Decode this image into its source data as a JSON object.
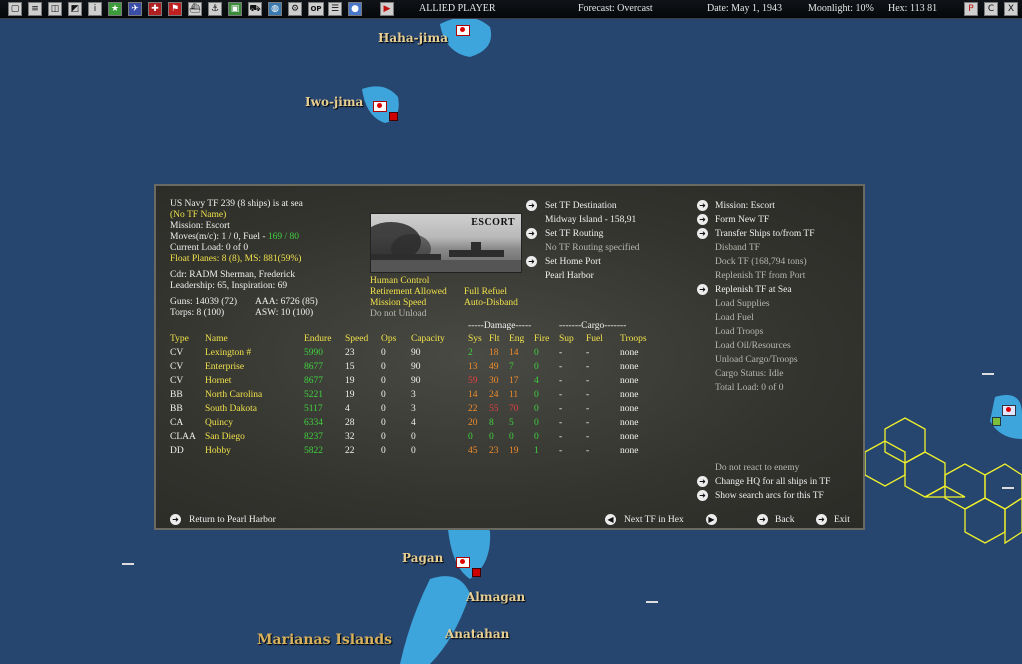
{
  "toolbar": {
    "icons": [
      "window-icon",
      "document-icon",
      "report-icon",
      "report2-icon",
      "info-icon",
      "star-icon",
      "plane-icon",
      "cross-icon",
      "flag-icon",
      "ship-icon",
      "anchor-icon",
      "map-icon",
      "fleet-icon",
      "globe-icon",
      "gear-icon",
      "op-icon",
      "list-icon",
      "circle-icon",
      "play-icon"
    ],
    "op_label": "OP",
    "player": "ALLIED PLAYER",
    "forecast": "Forecast: Overcast",
    "date": "Date: May 1, 1943",
    "moonlight": "Moonlight: 10%",
    "hex": "Hex: 113 81",
    "right_buttons": [
      "P",
      "C",
      "X"
    ]
  },
  "map": {
    "islands": [
      "Haha-jima",
      "Iwo-jima",
      "Pagan",
      "Almagan",
      "Anatahan",
      "Marianas Islands"
    ]
  },
  "panel": {
    "header": {
      "tf_line": "US Navy TF 239 (8 ships) is at sea",
      "tf_name": "(No TF Name)",
      "mission": "Mission:  Escort",
      "moves_prefix": "Moves(m/c): 1 / 0, Fuel - ",
      "fuel": "169 / 80",
      "current_load": "Current Load:  0 of 0",
      "float_planes": "Float Planes: 8 (8),  MS: 881(59%)",
      "commander": "Cdr: RADM  Sherman, Frederick",
      "leadership": "Leadership: 65, Inspiration: 69",
      "guns": "Guns: 14039 (72)",
      "aaa": "AAA: 6726 (85)",
      "torps": "Torps: 8 (100)",
      "asw": "ASW: 10 (100)"
    },
    "photo_label": "ESCORT",
    "control": {
      "human_control": "Human Control",
      "full_refuel": "Full Refuel",
      "retirement": "Retirement Allowed",
      "auto_disband": "Auto-Disband",
      "mission_speed": "Mission Speed",
      "do_not_unload": "Do not Unload"
    },
    "mid_actions": {
      "set_destination": "Set TF Destination",
      "destination_value": "Midway Island - 158,91",
      "set_routing": "Set TF Routing",
      "routing_value": "No TF Routing specified",
      "set_home_port": "Set Home Port",
      "home_port_value": "Pearl Harbor"
    },
    "right_actions": {
      "mission_escort": "Mission: Escort",
      "form_new_tf": "Form New TF",
      "transfer_ships": "Transfer Ships to/from TF",
      "disband_tf": "Disband TF",
      "dock_tf": "Dock TF (168,794 tons)",
      "replenish_port": "Replenish TF from Port",
      "replenish_sea": "Replenish TF at Sea",
      "load_supplies": "Load Supplies",
      "load_fuel": "Load Fuel",
      "load_troops": "Load Troops",
      "load_oil": "Load Oil/Resources",
      "unload_cargo": "Unload Cargo/Troops",
      "cargo_status": "Cargo Status: Idle",
      "total_load": "Total Load: 0 of 0",
      "no_react": "Do not react to enemy",
      "change_hq": "Change HQ for all ships in TF",
      "show_search": "Show search arcs for this TF"
    },
    "table": {
      "damage_group": "-----Damage-----",
      "cargo_group": "-------Cargo-------",
      "headers": {
        "type": "Type",
        "name": "Name",
        "endure": "Endure",
        "speed": "Speed",
        "ops": "Ops",
        "capacity": "Capacity",
        "sys": "Sys",
        "flt": "Flt",
        "eng": "Eng",
        "fire": "Fire",
        "sup": "Sup",
        "fuel": "Fuel",
        "troops": "Troops"
      },
      "rows": [
        {
          "type": "CV",
          "name": "Lexington #",
          "endure": "5990",
          "speed": "23",
          "ops": "0",
          "capacity": "90",
          "sys": "2",
          "flt": "18",
          "eng": "14",
          "fire": "0",
          "sup": "-",
          "fuel": "-",
          "troops": "none",
          "sys_c": "green",
          "flt_c": "orange",
          "eng_c": "orange"
        },
        {
          "type": "CV",
          "name": "Enterprise",
          "endure": "8677",
          "speed": "15",
          "ops": "0",
          "capacity": "90",
          "sys": "13",
          "flt": "49",
          "eng": "7",
          "fire": "0",
          "sup": "-",
          "fuel": "-",
          "troops": "none",
          "sys_c": "orange",
          "flt_c": "orange",
          "eng_c": "green"
        },
        {
          "type": "CV",
          "name": "Hornet",
          "endure": "8677",
          "speed": "19",
          "ops": "0",
          "capacity": "90",
          "sys": "59",
          "flt": "30",
          "eng": "17",
          "fire": "4",
          "sup": "-",
          "fuel": "-",
          "troops": "none",
          "sys_c": "red",
          "flt_c": "orange",
          "eng_c": "orange"
        },
        {
          "type": "BB",
          "name": "North Carolina",
          "endure": "5221",
          "speed": "19",
          "ops": "0",
          "capacity": "3",
          "sys": "14",
          "flt": "24",
          "eng": "11",
          "fire": "0",
          "sup": "-",
          "fuel": "-",
          "troops": "none",
          "sys_c": "orange",
          "flt_c": "orange",
          "eng_c": "orange"
        },
        {
          "type": "BB",
          "name": "South Dakota",
          "endure": "5117",
          "speed": "4",
          "ops": "0",
          "capacity": "3",
          "sys": "22",
          "flt": "55",
          "eng": "70",
          "fire": "0",
          "sup": "-",
          "fuel": "-",
          "troops": "none",
          "sys_c": "orange",
          "flt_c": "red",
          "eng_c": "red"
        },
        {
          "type": "CA",
          "name": "Quincy",
          "endure": "6334",
          "speed": "28",
          "ops": "0",
          "capacity": "4",
          "sys": "20",
          "flt": "8",
          "eng": "5",
          "fire": "0",
          "sup": "-",
          "fuel": "-",
          "troops": "none",
          "sys_c": "orange",
          "flt_c": "green",
          "eng_c": "green"
        },
        {
          "type": "CLAA",
          "name": "San Diego",
          "endure": "8237",
          "speed": "32",
          "ops": "0",
          "capacity": "0",
          "sys": "0",
          "flt": "0",
          "eng": "0",
          "fire": "0",
          "sup": "-",
          "fuel": "-",
          "troops": "none",
          "sys_c": "green",
          "flt_c": "green",
          "eng_c": "green"
        },
        {
          "type": "DD",
          "name": "Hobby",
          "endure": "5822",
          "speed": "22",
          "ops": "0",
          "capacity": "0",
          "sys": "45",
          "flt": "23",
          "eng": "19",
          "fire": "1",
          "sup": "-",
          "fuel": "-",
          "troops": "none",
          "sys_c": "orange",
          "flt_c": "orange",
          "eng_c": "orange"
        }
      ]
    },
    "footer": {
      "return_label": "Return to Pearl Harbor",
      "next_tf": "Next TF in Hex",
      "back": "Back",
      "exit": "Exit"
    }
  },
  "colors": {
    "yellow": "#f0e24a",
    "green": "#3fd13f",
    "orange": "#f08c2a",
    "red": "#e04040",
    "sea": "#2a4a77",
    "shallow": "#3fa0d8"
  }
}
